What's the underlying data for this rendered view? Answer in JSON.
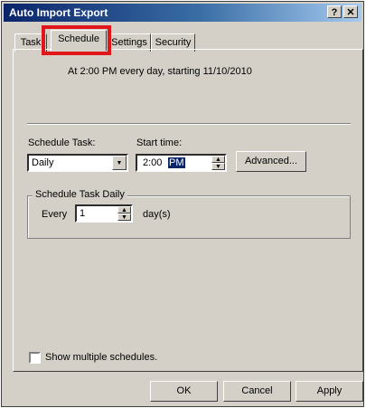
{
  "window": {
    "title": "Auto Import Export",
    "help_button": "?",
    "close_button": "✕"
  },
  "tabs": [
    {
      "label": "Task"
    },
    {
      "label": "Schedule",
      "active": true
    },
    {
      "label": "Settings"
    },
    {
      "label": "Security"
    }
  ],
  "schedule": {
    "summary": "At 2:00 PM every day, starting 11/10/2010",
    "task_label": "Schedule Task:",
    "task_value": "Daily",
    "start_time_label": "Start time:",
    "start_time_hour": "2:00",
    "start_time_ampm": "PM",
    "advanced_button": "Advanced...",
    "group_label": "Schedule Task Daily",
    "every_label": "Every",
    "every_value": "1",
    "unit_label": "day(s)",
    "multiple_label": "Show multiple schedules."
  },
  "buttons": {
    "ok": "OK",
    "cancel": "Cancel",
    "apply": "Apply"
  },
  "colors": {
    "title_bar": "#0a246a",
    "highlight_box": "#e0161b",
    "dialog": "#d4d0c8"
  }
}
